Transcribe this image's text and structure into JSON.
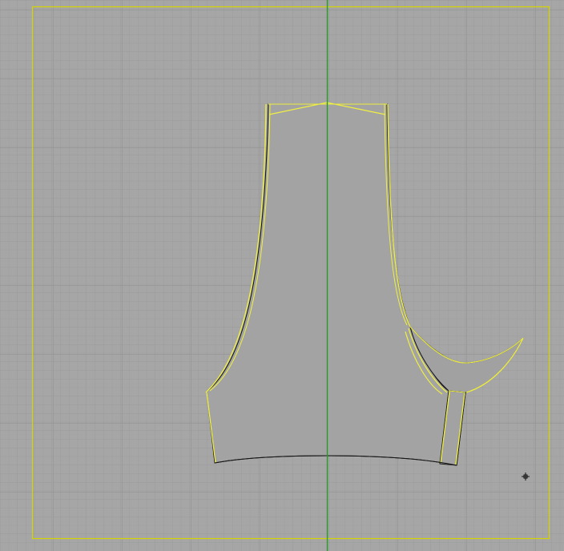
{
  "viewport": {
    "mode": "2d-pattern-view",
    "background_color": "#a6a6a6",
    "grid_minor_color": "#9a9a9a",
    "grid_major_color": "#8e8e8e",
    "frame_color": "#d6d600",
    "center_axis_color": "#1e9e1e"
  },
  "pattern": {
    "piece_fill_color": "#a0a0a0",
    "outline_color": "#111111",
    "seam_color": "#f0f040",
    "pieces": [
      "front-body-panel",
      "armhole-facing",
      "side-strip"
    ]
  },
  "cursor": {
    "icon": "crosshair-cursor-icon"
  }
}
